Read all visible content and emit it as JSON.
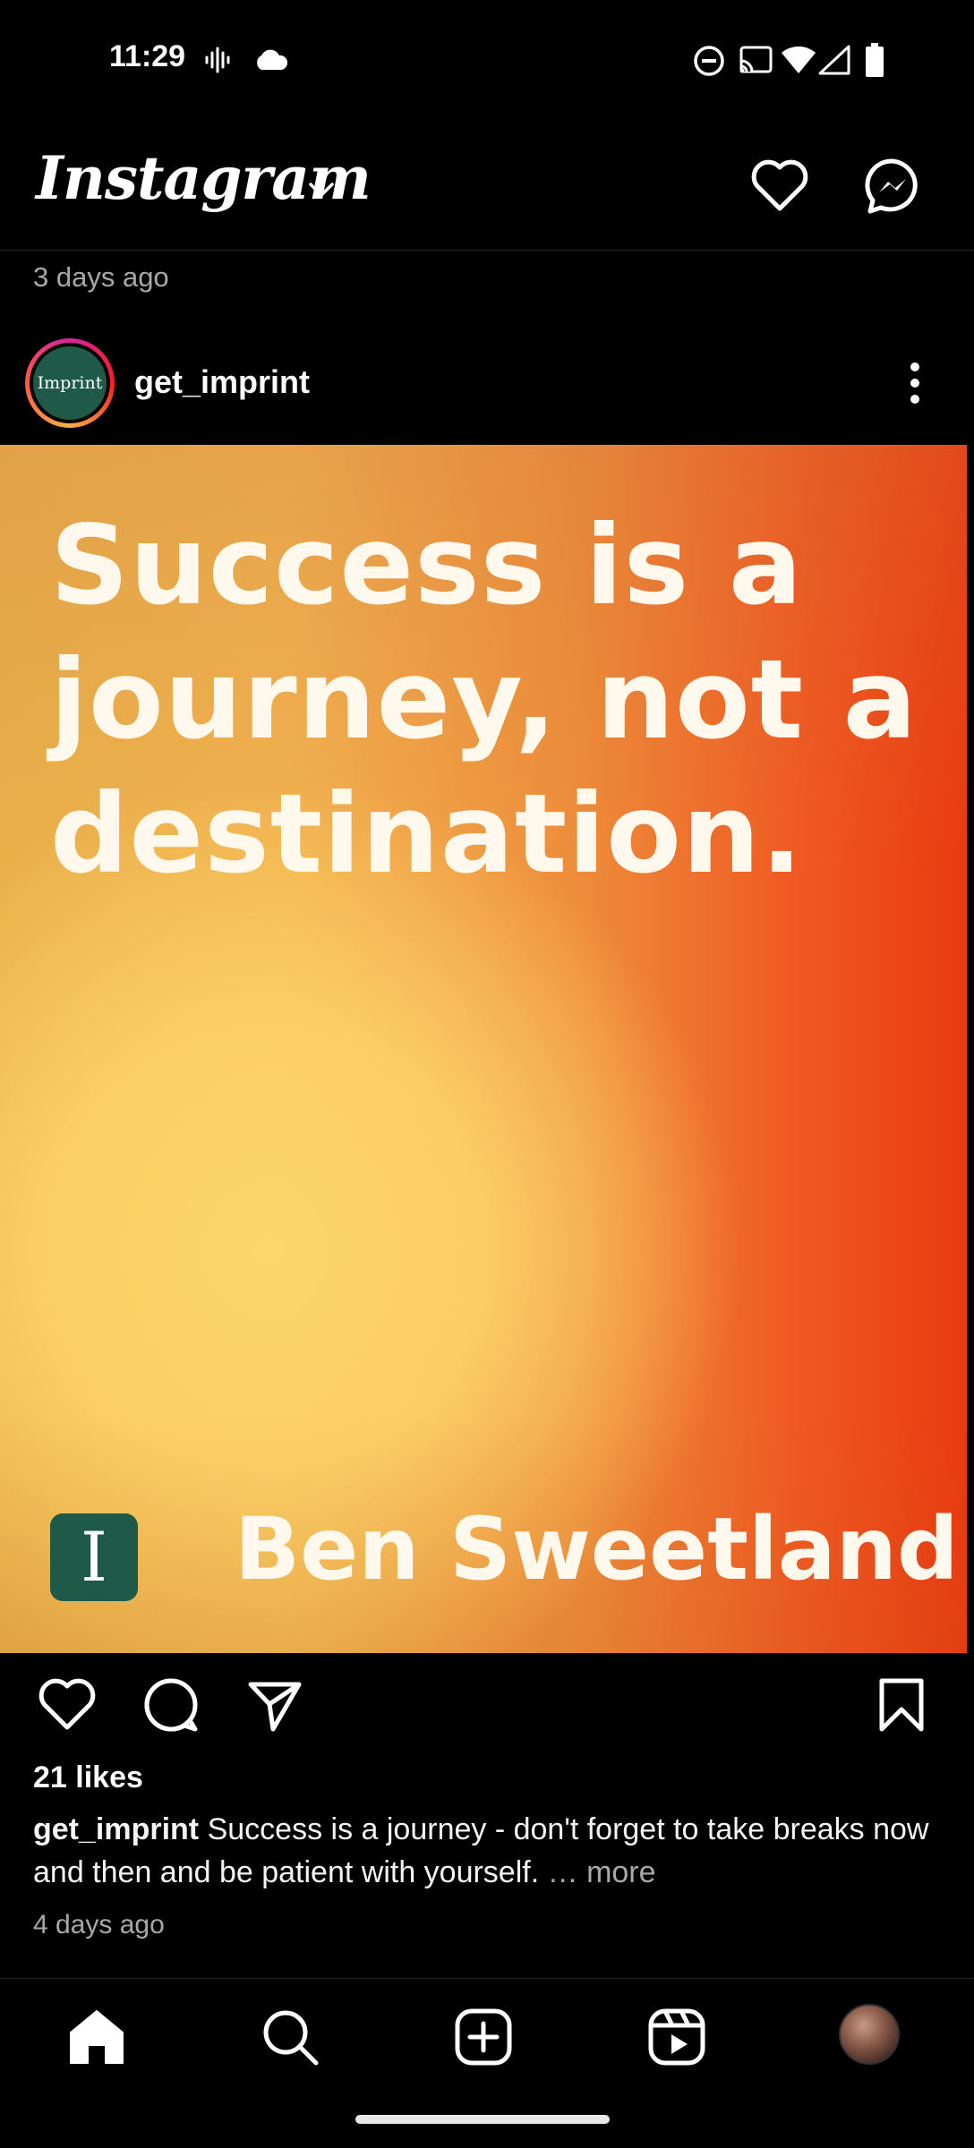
{
  "status_bar": {
    "time": "11:29",
    "icons": [
      "voicemail-wave-icon",
      "cloud-icon",
      "do-not-disturb-icon",
      "cast-icon",
      "wifi-icon",
      "cell-signal-icon",
      "battery-icon"
    ]
  },
  "header": {
    "brand": "Instagram",
    "icons": [
      "chevron-down-icon",
      "heart-icon",
      "messenger-icon"
    ]
  },
  "previous_post": {
    "time": "3 days ago"
  },
  "post": {
    "avatar_text": "Imprint",
    "username": "get_imprint",
    "image": {
      "quote": "Success is a journey, not a destination.",
      "logo_letter": "I",
      "author": "Ben Sweetland",
      "colors": {
        "yellow": "#fdd56a",
        "orange": "#ee8c3a",
        "red": "#ea3a10",
        "logo_green": "#1e5a47"
      }
    },
    "likes": "21 likes",
    "caption_user": "get_imprint",
    "caption_text": " Success is a journey - don't forget to take breaks now and then and be patient with yourself.",
    "caption_more": " … more",
    "time": "4 days ago"
  },
  "bottom_nav": {
    "items": [
      "home-icon",
      "search-icon",
      "create-icon",
      "reels-icon",
      "profile-avatar"
    ]
  }
}
